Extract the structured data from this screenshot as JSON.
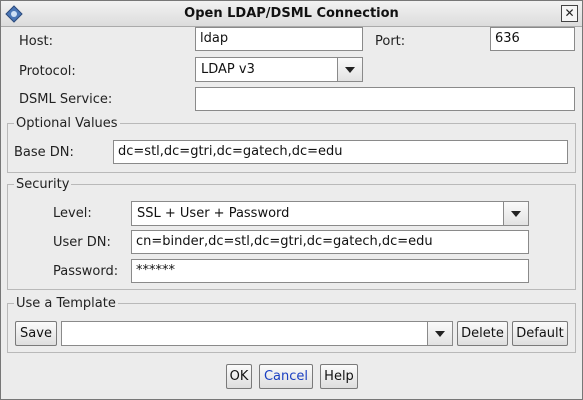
{
  "window": {
    "title": "Open LDAP/DSML Connection",
    "close_glyph": "✕"
  },
  "connection": {
    "host_label": "Host:",
    "host_value": "ldap",
    "port_label": "Port:",
    "port_value": "636",
    "protocol_label": "Protocol:",
    "protocol_value": "LDAP v3",
    "dsml_label": "DSML Service:",
    "dsml_value": ""
  },
  "optional": {
    "title": "Optional Values",
    "base_dn_label": "Base DN:",
    "base_dn_value": "dc=stl,dc=gtri,dc=gatech,dc=edu"
  },
  "security": {
    "title": "Security",
    "level_label": "Level:",
    "level_value": "SSL + User + Password",
    "user_dn_label": "User DN:",
    "user_dn_value": "cn=binder,dc=stl,dc=gtri,dc=gatech,dc=edu",
    "password_label": "Password:",
    "password_value": "******"
  },
  "template": {
    "title": "Use a Template",
    "save_label": "Save",
    "selected": "",
    "delete_label": "Delete",
    "default_label": "Default"
  },
  "buttons": {
    "ok": "OK",
    "cancel": "Cancel",
    "help": "Help"
  },
  "icons": {
    "app": "ldap-app-icon",
    "close": "close-icon",
    "dropdown": "chevron-down-icon"
  },
  "colors": {
    "cancel_text": "#1a3fc2"
  }
}
